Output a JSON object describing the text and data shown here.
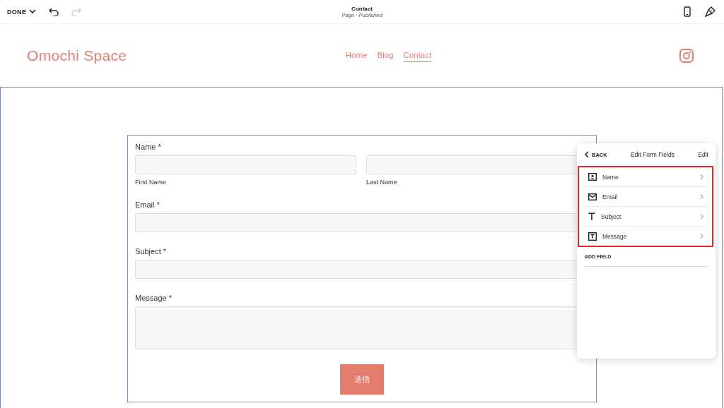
{
  "topbar": {
    "done_label": "DONE",
    "undo": {
      "disabled": false
    },
    "redo": {
      "disabled": true
    },
    "title": "Contact",
    "subtitle": "Page · Published"
  },
  "site": {
    "logo": "Omochi Space",
    "nav": [
      {
        "label": "Home",
        "selected": false
      },
      {
        "label": "Blog",
        "selected": false
      },
      {
        "label": "Contact",
        "selected": true
      }
    ]
  },
  "form": {
    "fields": [
      {
        "kind": "name",
        "label": "Name *",
        "sublabels": [
          "First Name",
          "Last Name"
        ]
      },
      {
        "kind": "text",
        "label": "Email *"
      },
      {
        "kind": "text",
        "label": "Subject *"
      },
      {
        "kind": "textarea",
        "label": "Message *"
      }
    ],
    "submit": "送信"
  },
  "panel": {
    "back": "BACK",
    "title": "Edit Form Fields",
    "edit": "Edit",
    "fields": [
      {
        "kind": "name",
        "label": "Name"
      },
      {
        "kind": "email",
        "label": "Email"
      },
      {
        "kind": "text",
        "label": "Subject"
      },
      {
        "kind": "textarea",
        "label": "Message"
      }
    ],
    "add_field": "ADD FIELD"
  }
}
